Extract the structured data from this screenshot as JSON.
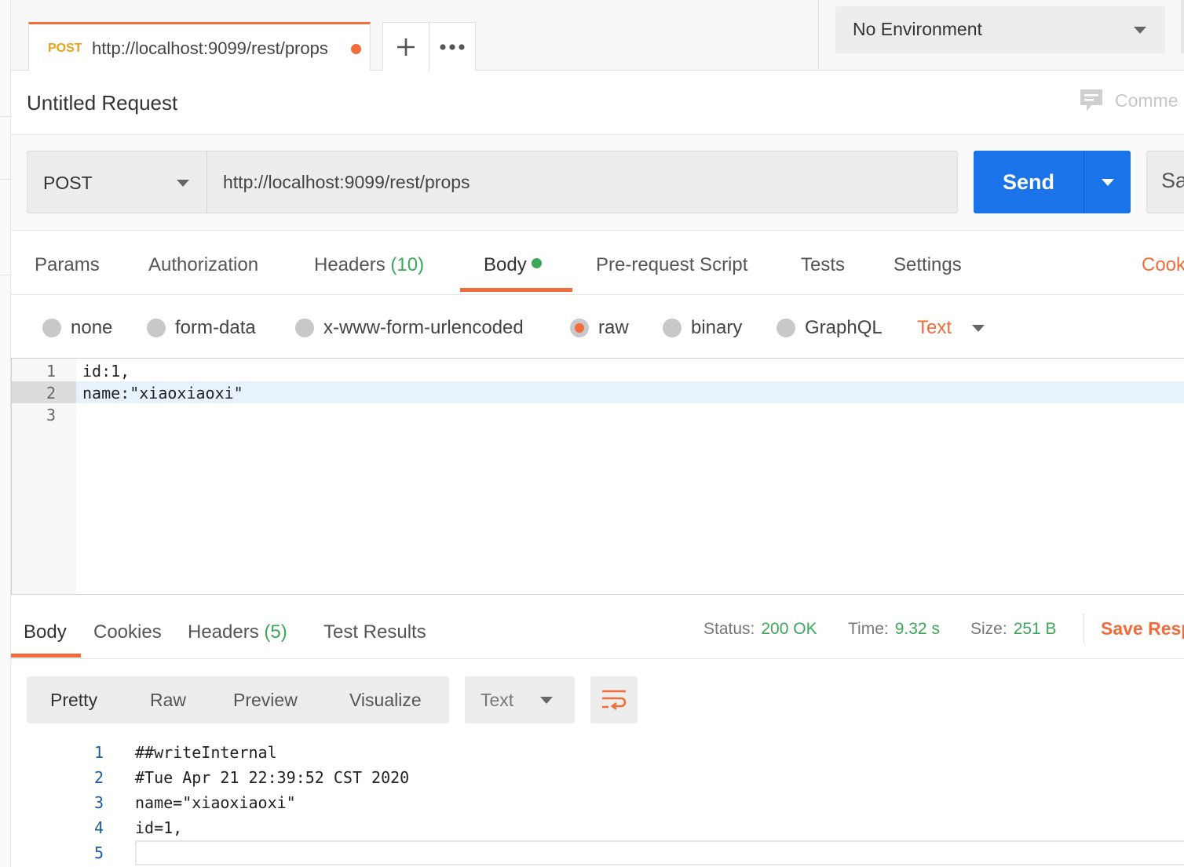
{
  "tab": {
    "method": "POST",
    "url": "http://localhost:9099/rest/props"
  },
  "environment": {
    "selected": "No Environment"
  },
  "request": {
    "title": "Untitled Request",
    "comments_label": "Comme",
    "method": "POST",
    "url": "http://localhost:9099/rest/props",
    "send_label": "Send",
    "save_label": "Sa"
  },
  "request_tabs": [
    {
      "label": "Params"
    },
    {
      "label": "Authorization"
    },
    {
      "label": "Headers",
      "count": "(10)"
    },
    {
      "label": "Body"
    },
    {
      "label": "Pre-request Script"
    },
    {
      "label": "Tests"
    },
    {
      "label": "Settings"
    }
  ],
  "cookies_link": "Cook",
  "body_types": [
    {
      "label": "none",
      "selected": false
    },
    {
      "label": "form-data",
      "selected": false
    },
    {
      "label": "x-www-form-urlencoded",
      "selected": false
    },
    {
      "label": "raw",
      "selected": true
    },
    {
      "label": "binary",
      "selected": false
    },
    {
      "label": "GraphQL",
      "selected": false
    }
  ],
  "raw_format": "Text",
  "editor": {
    "lines": [
      {
        "num": "1",
        "code": "id:1,"
      },
      {
        "num": "2",
        "code": "name:\"xiaoxiaoxi\""
      },
      {
        "num": "3",
        "code": ""
      }
    ]
  },
  "response": {
    "tabs": [
      {
        "label": "Body"
      },
      {
        "label": "Cookies"
      },
      {
        "label": "Headers",
        "count": "(5)"
      },
      {
        "label": "Test Results"
      }
    ],
    "status_label": "Status:",
    "status_value": "200 OK",
    "time_label": "Time:",
    "time_value": "9.32 s",
    "size_label": "Size:",
    "size_value": "251 B",
    "save_label": "Save Resp",
    "views": [
      "Pretty",
      "Raw",
      "Preview",
      "Visualize"
    ],
    "format": "Text",
    "lines": [
      {
        "num": "1",
        "code": "##writeInternal"
      },
      {
        "num": "2",
        "code": "#Tue Apr 21 22:39:52 CST 2020"
      },
      {
        "num": "3",
        "code": "name=\"xiaoxiaoxi\""
      },
      {
        "num": "4",
        "code": "id=1,"
      },
      {
        "num": "5",
        "code": ""
      }
    ]
  },
  "colors": {
    "accent": "#f26b3a",
    "send": "#1a73e8",
    "success": "#3aa856",
    "method_post": "#e8a317"
  }
}
